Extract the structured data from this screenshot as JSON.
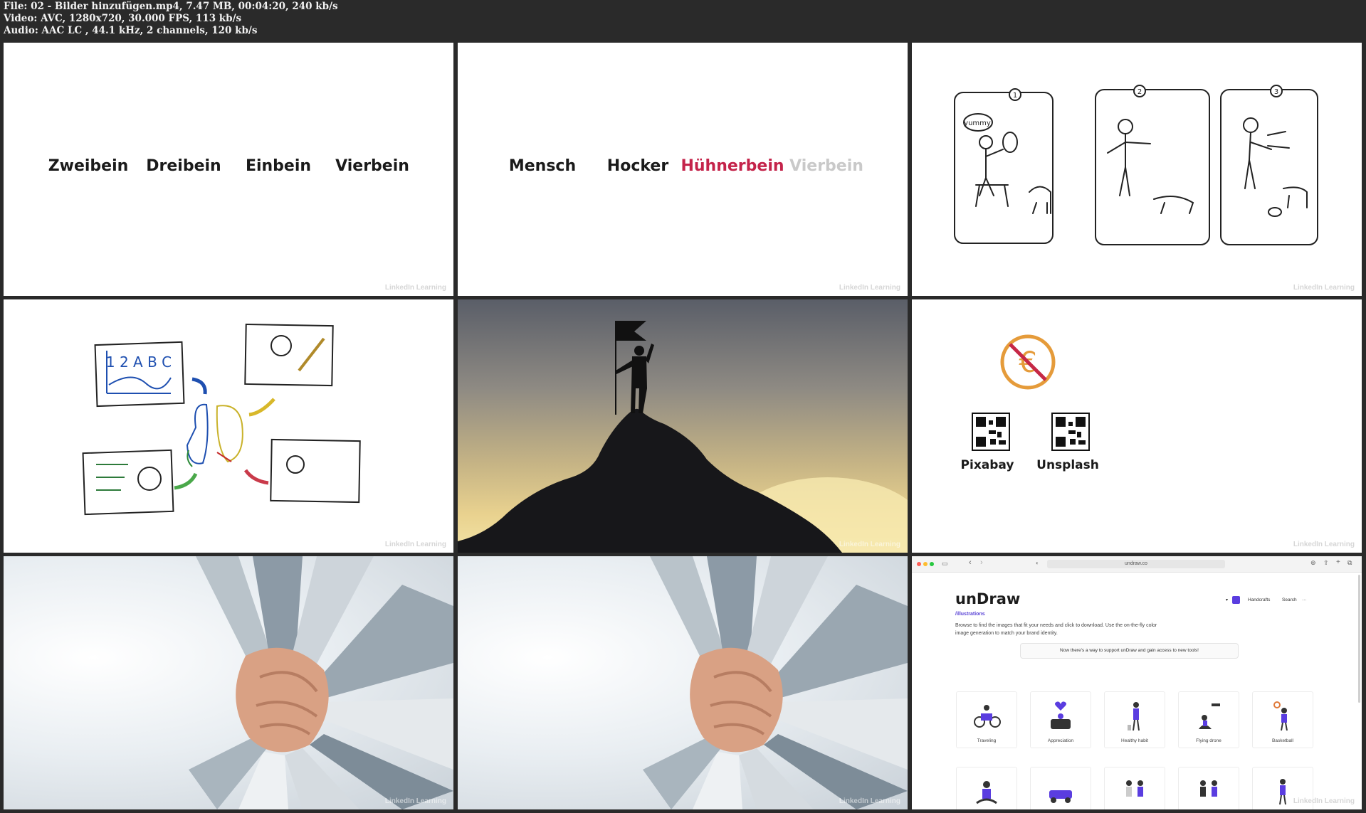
{
  "header": {
    "file": "File: 02 - Bilder hinzufügen.mp4, 7.47 MB, 00:04:20, 240 kb/s",
    "video": "Video: AVC, 1280x720, 30.000 FPS, 113 kb/s",
    "audio": "Audio: AAC LC , 44.1 kHz, 2 channels, 120 kb/s"
  },
  "watermark": "LinkedIn Learning",
  "frame1": {
    "words": [
      "Zweibein",
      "Dreibein",
      "Einbein",
      "Vierbein"
    ]
  },
  "frame2": {
    "words": [
      "Mensch",
      "Hocker",
      "Hühnerbein",
      "Vierbein"
    ]
  },
  "frame3": {
    "panels": [
      "1",
      "2",
      "3"
    ],
    "speech": "yummy"
  },
  "frame4": {
    "chart_text": "1 2 A B C"
  },
  "frame6": {
    "labels": [
      "Pixabay",
      "Unsplash"
    ],
    "icon": "no-euro-icon"
  },
  "frame9": {
    "url": "undraw.co",
    "title": "unDraw",
    "subtitle": "/illustrations",
    "description": "Browse to find the images that fit your needs and click to download. Use the on-the-fly color image generation to match your brand identity.",
    "menu": [
      "Handcrafts",
      "Search",
      "···"
    ],
    "banner": "Now there's a way to support unDraw and gain access to new tools!",
    "cards": [
      "Traveling",
      "Appreciation",
      "Healthy habit",
      "Flying drone",
      "Basketball"
    ],
    "accent": "#5a3de0"
  }
}
